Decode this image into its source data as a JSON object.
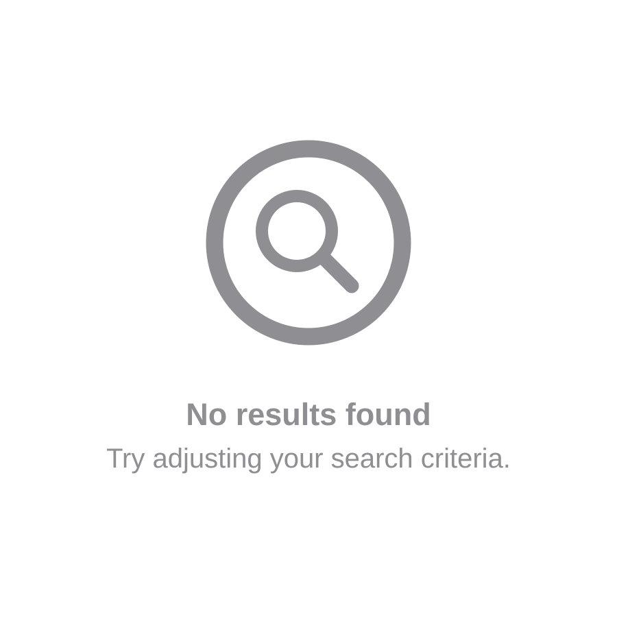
{
  "empty_state": {
    "icon": "magnifying-glass-in-circle-icon",
    "icon_color": "#8e8e93",
    "title": "No results found",
    "message": "Try adjusting your search criteria."
  }
}
